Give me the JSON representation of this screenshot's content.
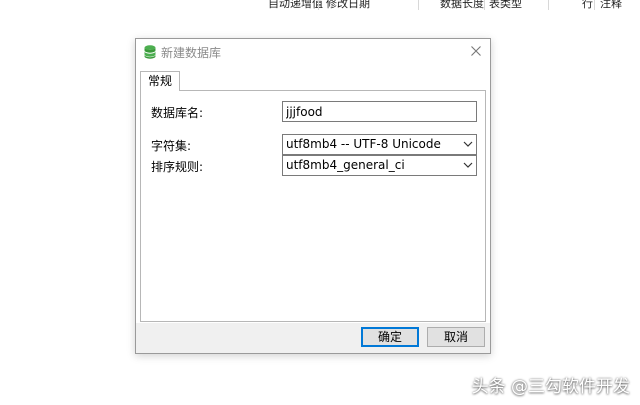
{
  "background": {
    "columns": [
      "自动递增值",
      "修改日期",
      "数据长度",
      "表类型",
      "行",
      "注释"
    ]
  },
  "dialog": {
    "title": "新建数据库",
    "icon": "database-icon",
    "close_icon": "close-icon",
    "tab": "常规",
    "fields": {
      "db_name_label": "数据库名:",
      "db_name_value": "jjjfood",
      "charset_label": "字符集:",
      "charset_value": "utf8mb4 -- UTF-8 Unicode",
      "collation_label": "排序规则:",
      "collation_value": "utf8mb4_general_ci"
    },
    "buttons": {
      "ok": "确定",
      "cancel": "取消"
    }
  },
  "watermark": "头条 @三勾软件开发",
  "colors": {
    "accent": "#0078d7",
    "icon_green": "#3a9a3a"
  }
}
